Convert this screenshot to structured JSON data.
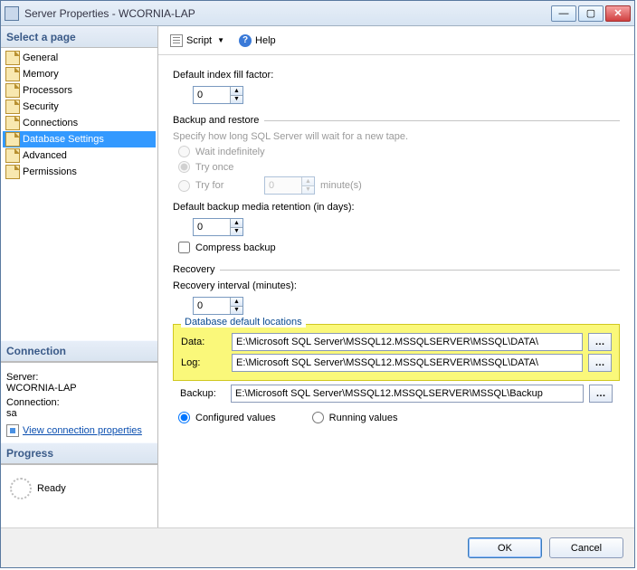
{
  "window_title": "Server Properties - WCORNIA-LAP",
  "sidebar": {
    "select_page": "Select a page",
    "items": [
      "General",
      "Memory",
      "Processors",
      "Security",
      "Connections",
      "Database Settings",
      "Advanced",
      "Permissions"
    ],
    "selected_index": 5,
    "connection_hdr": "Connection",
    "server_lbl": "Server:",
    "server_val": "WCORNIA-LAP",
    "conn_lbl": "Connection:",
    "conn_val": "sa",
    "view_props": "View connection properties",
    "progress_hdr": "Progress",
    "progress_val": "Ready"
  },
  "toolbar": {
    "script": "Script",
    "help": "Help"
  },
  "main": {
    "fill_factor_lbl": "Default index fill factor:",
    "fill_factor_val": "0",
    "backup_restore_hdr": "Backup and restore",
    "tape_hint": "Specify how long SQL Server will wait for a new tape.",
    "wait_indef": "Wait indefinitely",
    "try_once": "Try once",
    "try_for": "Try for",
    "try_for_val": "0",
    "try_for_unit": "minute(s)",
    "retention_lbl": "Default backup media retention (in days):",
    "retention_val": "0",
    "compress_lbl": "Compress backup",
    "recovery_hdr": "Recovery",
    "recovery_interval_lbl": "Recovery interval (minutes):",
    "recovery_interval_val": "0",
    "loc_hdr": "Database default locations",
    "data_lbl": "Data:",
    "data_val": "E:\\Microsoft SQL Server\\MSSQL12.MSSQLSERVER\\MSSQL\\DATA\\",
    "log_lbl": "Log:",
    "log_val": "E:\\Microsoft SQL Server\\MSSQL12.MSSQLSERVER\\MSSQL\\DATA\\",
    "backup_lbl": "Backup:",
    "backup_val": "E:\\Microsoft SQL Server\\MSSQL12.MSSQLSERVER\\MSSQL\\Backup",
    "configured": "Configured values",
    "running": "Running values"
  },
  "footer": {
    "ok": "OK",
    "cancel": "Cancel"
  }
}
